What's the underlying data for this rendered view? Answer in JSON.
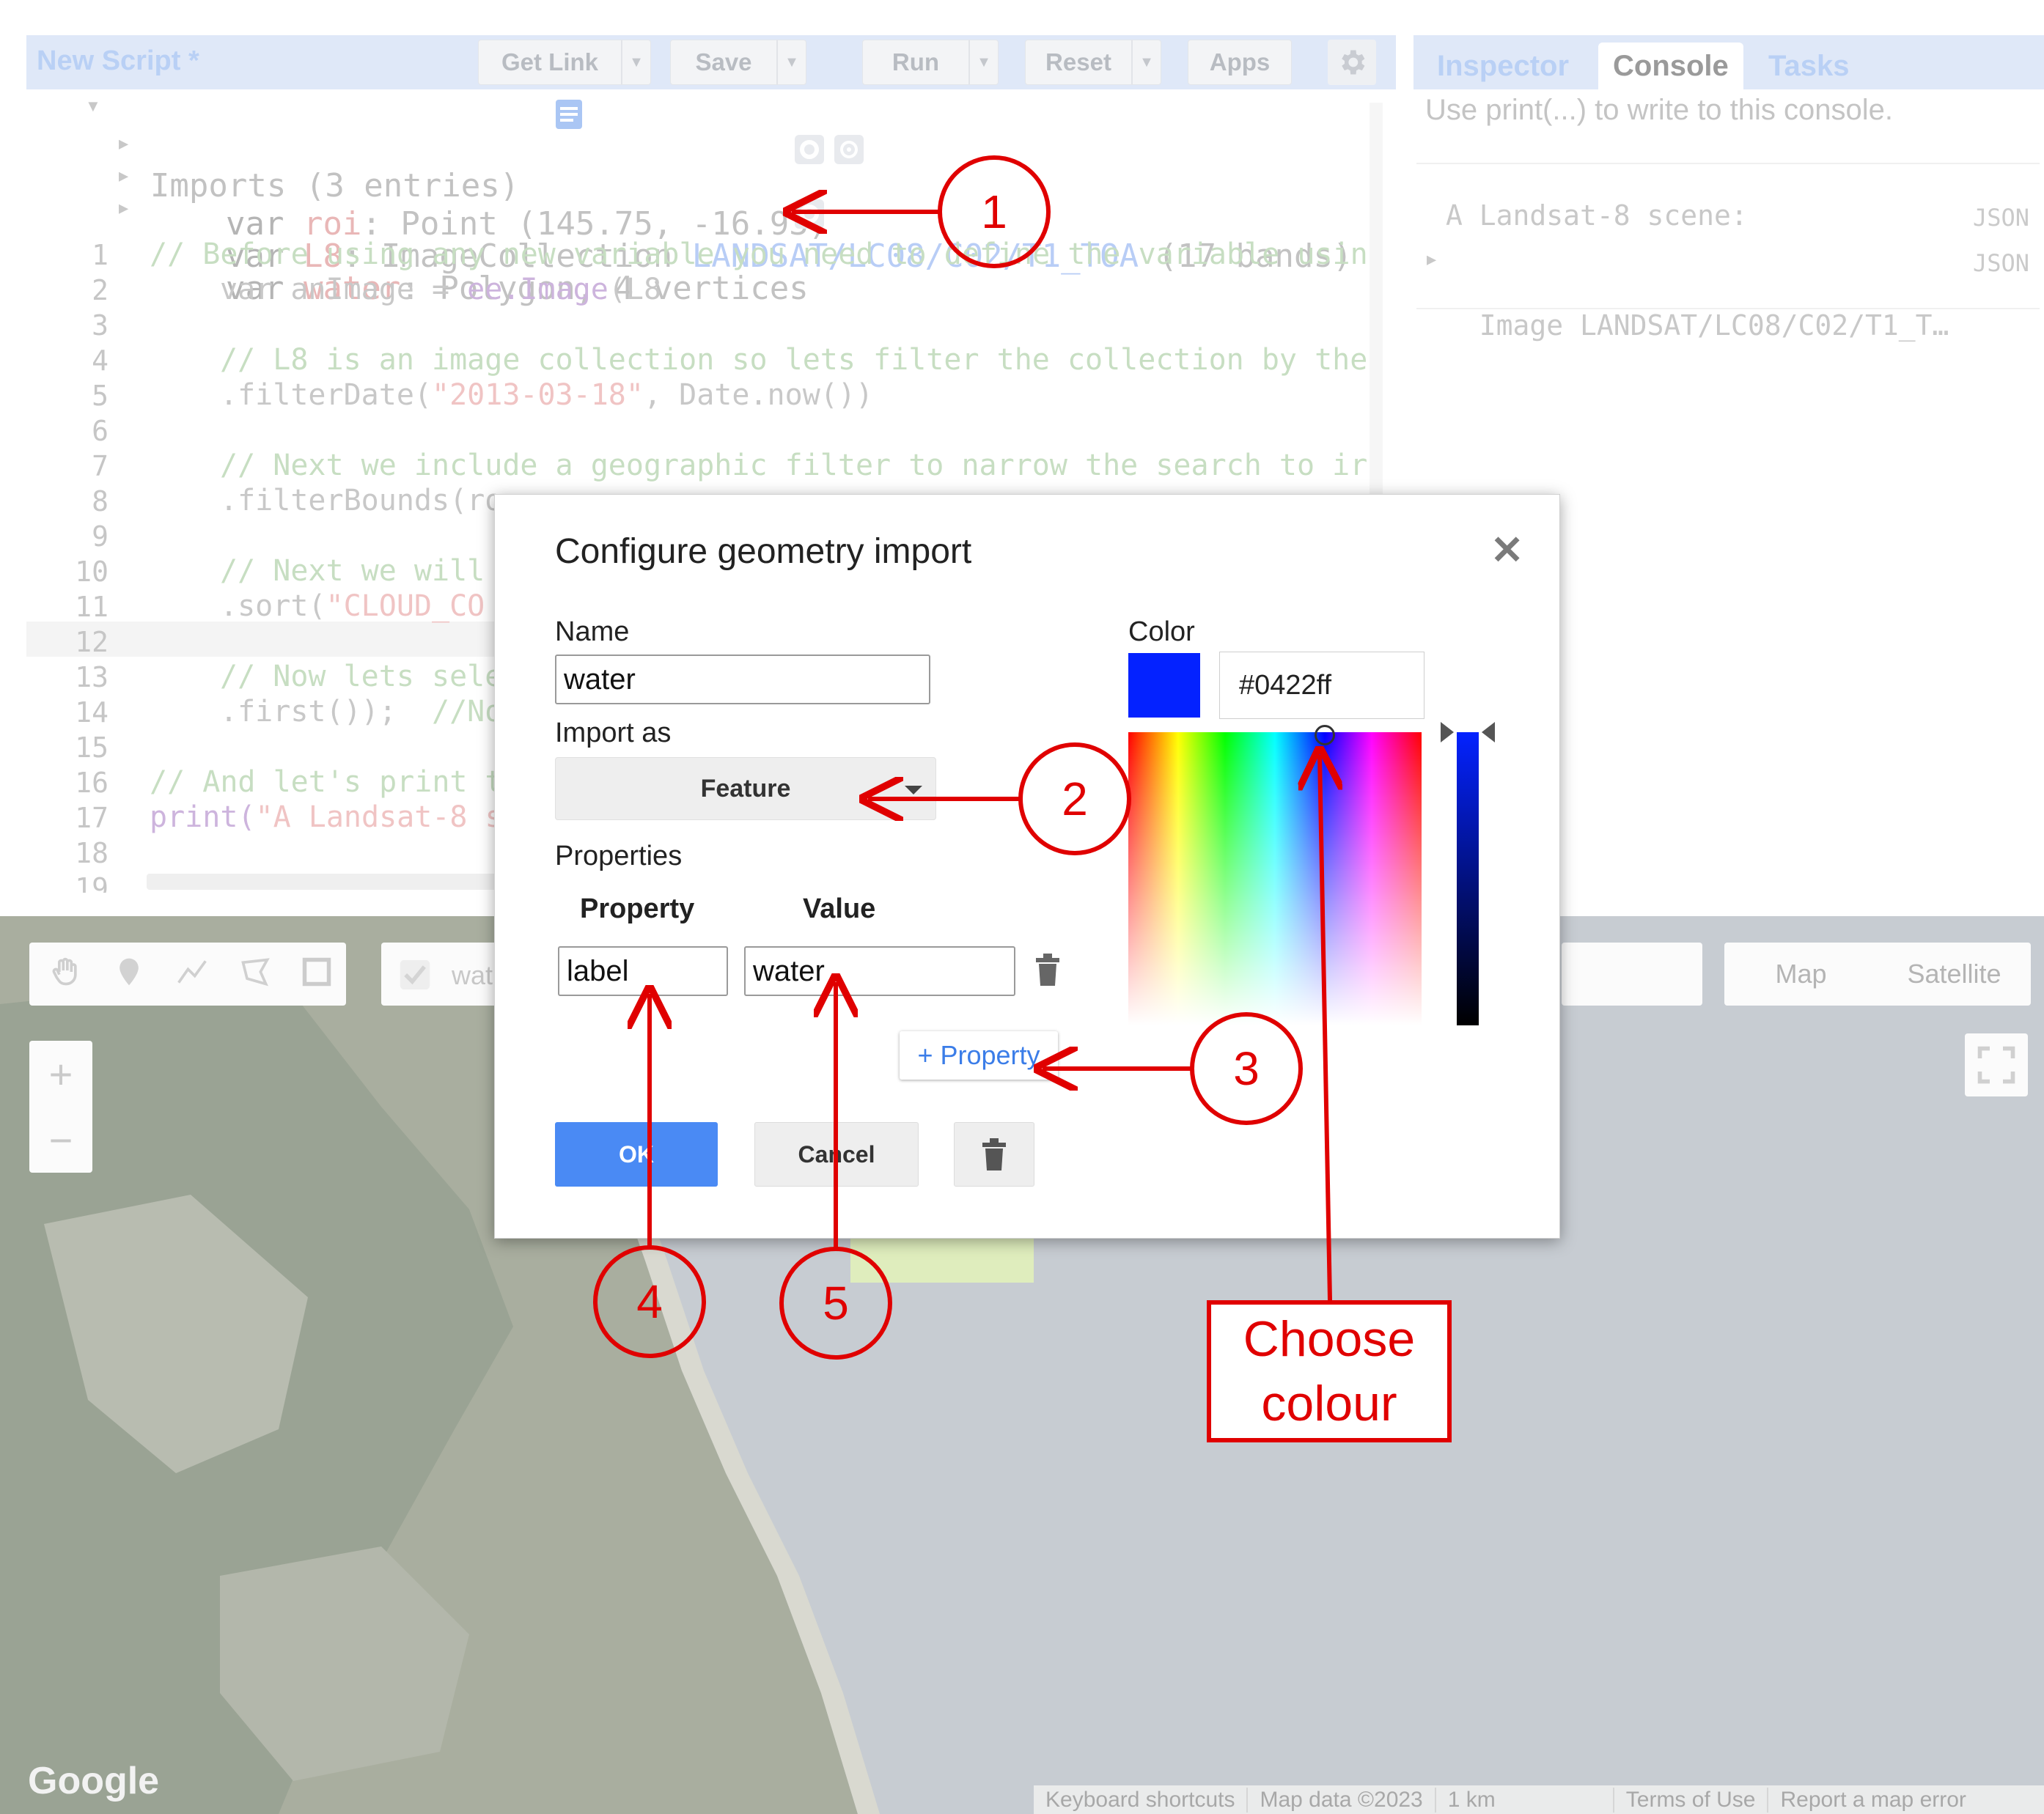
{
  "editor": {
    "title": "New Script *",
    "toolbar": {
      "get_link": "Get Link",
      "save": "Save",
      "run": "Run",
      "reset": "Reset",
      "apps": "Apps"
    },
    "imports": {
      "header": "Imports (3 entries)",
      "entries": [
        {
          "kw": "var",
          "name": "roi",
          "desc": " Point (145.75, -16.93)"
        },
        {
          "kw": "var",
          "name": "L8",
          "desc": " ImageCollection ",
          "link": "LANDSAT/LC08/C02/T1_TOA",
          "extra": " (17 bands)"
        },
        {
          "kw": "var",
          "name": "water",
          "desc": " Polygon, 4 vertices"
        }
      ]
    },
    "line_numbers": [
      "1",
      "2",
      "3",
      "4",
      "5",
      "6",
      "7",
      "8",
      "9",
      "10",
      "11",
      "12",
      "13",
      "14",
      "15",
      "16",
      "17",
      "18",
      "19"
    ],
    "code": {
      "l1": "// Before using any new variable you need to define the variable usin",
      "l2a": "var anImage = ",
      "l2b": "ee.Image",
      "l2c": "(L8",
      "l4": "// L8 is an image collection so lets filter the collection by the",
      "l5a": ".filterDate(",
      "l5b": "\"2013-03-18\"",
      "l5c": ", Date.now())",
      "l7": "// Next we include a geographic filter to narrow the search to ir",
      "l8": ".filterBounds(ro",
      "l10": "// Next we will",
      "l11a": ".sort(",
      "l11b": "\"CLOUD_CO",
      "l13": "// Now lets sele",
      "l14a": ".first());  ",
      "l14b": "//No",
      "l16": "// And let's print t",
      "l17a": "print(",
      "l17b": "\"A Landsat-8 s"
    }
  },
  "right_panel": {
    "tabs": [
      "Inspector",
      "Console",
      "Tasks"
    ],
    "hint": "Use print(...) to write to this console.",
    "lines": [
      {
        "text": "A Landsat-8 scene:",
        "tag": "JSON"
      },
      {
        "text": "Image LANDSAT/LC08/C02/T1_T…",
        "tag": "JSON"
      }
    ]
  },
  "map": {
    "layer_chip": "wat",
    "map_type": [
      "Map",
      "Satellite"
    ],
    "zoom_in": "+",
    "zoom_out": "−",
    "logo": "Google",
    "footer": [
      "Keyboard shortcuts",
      "Map data ©2023",
      "1 km",
      "Terms of Use",
      "Report a map error"
    ]
  },
  "dialog": {
    "title": "Configure geometry import",
    "close": "✕",
    "name_label": "Name",
    "name_value": "water",
    "import_as_label": "Import as",
    "import_as_value": "Feature",
    "properties_label": "Properties",
    "property_header": "Property",
    "value_header": "Value",
    "property_key": "label",
    "property_value": "water",
    "add_property": "+ Property",
    "ok": "OK",
    "cancel": "Cancel",
    "color_label": "Color",
    "color_hex": "#0422ff"
  },
  "annotations": {
    "n1": "1",
    "n2": "2",
    "n3": "3",
    "n4": "4",
    "n5": "5",
    "choose_line1": "Choose",
    "choose_line2": "colour",
    "color": "#e00000"
  }
}
